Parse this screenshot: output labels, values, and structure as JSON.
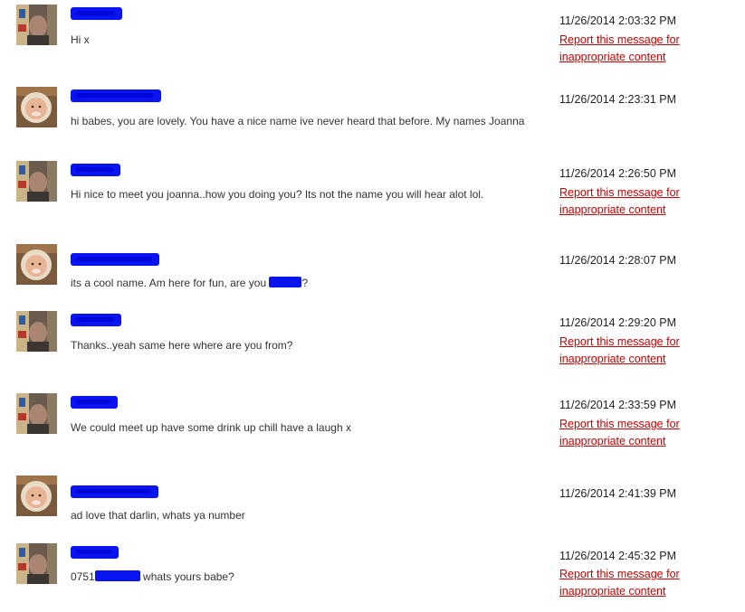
{
  "report_label": "Report this message for inappropriate content",
  "messages": [
    {
      "sender": "man",
      "time": "11/26/2014 2:03:32 PM",
      "text": "Hi x",
      "reportable": true
    },
    {
      "sender": "woman",
      "time": "11/26/2014 2:23:31 PM",
      "text": "hi babes, you are lovely. You have a nice name ive never heard that before. My names Joanna",
      "reportable": false
    },
    {
      "sender": "man",
      "time": "11/26/2014 2:26:50 PM",
      "text": "Hi nice to meet you joanna..how you doing you? Its not the name you will hear alot lol.",
      "reportable": true
    },
    {
      "sender": "woman",
      "time": "11/26/2014 2:28:07 PM",
      "text_before": "its a cool name. Am here for fun, are you",
      "text_after": "?",
      "reportable": false
    },
    {
      "sender": "man",
      "time": "11/26/2014 2:29:20 PM",
      "text": "Thanks..yeah same here where are you from?",
      "reportable": true
    },
    {
      "sender": "man",
      "time": "11/26/2014 2:33:59 PM",
      "text": "We could meet up have some drink up chill have a laugh x",
      "reportable": true
    },
    {
      "sender": "woman",
      "time": "11/26/2014 2:41:39 PM",
      "text": "ad love that darlin, whats ya number",
      "reportable": false
    },
    {
      "sender": "man",
      "time": "11/26/2014 2:45:32 PM",
      "text_before": "0751",
      "text_after": "whats yours babe?",
      "reportable": true
    }
  ]
}
